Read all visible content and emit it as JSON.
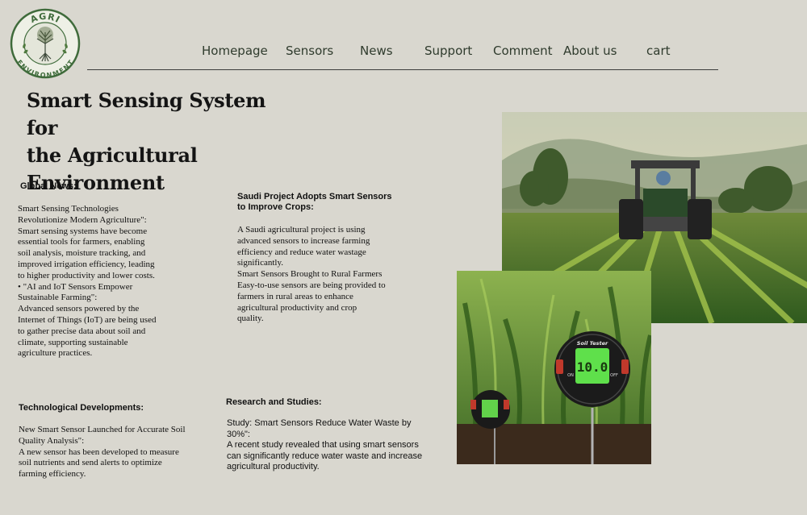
{
  "logo": {
    "top_text": "AGRI",
    "bottom_text": "ENVIRONMENT"
  },
  "nav": {
    "items": [
      "Homepage",
      "Sensors",
      "News",
      "Support",
      "Comment",
      "About us",
      "cart"
    ]
  },
  "hero": {
    "title_lines": [
      "Smart Sensing System for",
      "the Agricultural",
      "Environment"
    ]
  },
  "global_news": {
    "heading": "Global News:",
    "lines": [
      " Smart Sensing Technologies",
      "Revolutionize Modern Agriculture\":",
      "Smart sensing systems have become",
      "essential tools for farmers, enabling",
      "soil analysis, moisture tracking, and",
      "improved irrigation efficiency, leading",
      "to higher productivity and lower costs.",
      " • \"AI and IoT Sensors Empower",
      "Sustainable Farming\":",
      "Advanced sensors powered by the",
      "Internet of Things (IoT) are being used",
      "to gather precise data about soil and",
      "climate, supporting sustainable",
      "agriculture practices."
    ]
  },
  "saudi": {
    "heading_lines": [
      "Saudi Project Adopts Smart Sensors",
      "to Improve Crops:"
    ],
    "lines": [
      "A Saudi agricultural project is using",
      "advanced sensors to increase farming",
      "efficiency and reduce water wastage",
      "significantly.",
      " Smart Sensors Brought to Rural Farmers",
      "Easy-to-use sensors are being provided to",
      "farmers in rural areas to enhance",
      "agricultural productivity and crop",
      "quality."
    ]
  },
  "tech": {
    "heading": "Technological Developments:",
    "lines": [
      "  New Smart Sensor Launched for Accurate Soil",
      "Quality Analysis\":",
      "A new sensor has been developed to measure",
      "soil nutrients and send alerts to optimize",
      "farming efficiency."
    ]
  },
  "research": {
    "heading": "Research and Studies:",
    "lines": [
      " Study: Smart Sensors Reduce Water Waste by",
      "30%\":",
      "A recent study revealed that using smart sensors",
      "can significantly reduce water waste and increase",
      "agricultural productivity."
    ]
  },
  "images": {
    "tractor": "tractor-field-photo",
    "sensor": "soil-tester-photo",
    "sensor_label": "Soil Tester",
    "sensor_on": "ON",
    "sensor_off": "OFF"
  },
  "colors": {
    "background": "#d9d7cf",
    "nav_text": "#2f3b2d",
    "logo_green": "#3f6b3b"
  }
}
